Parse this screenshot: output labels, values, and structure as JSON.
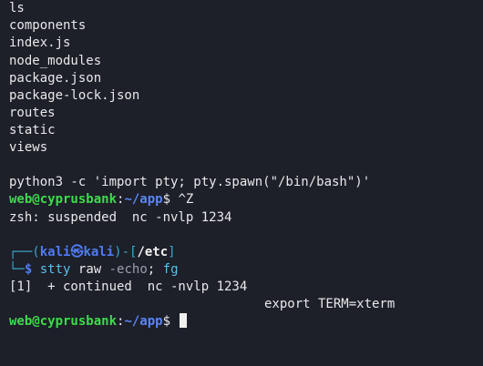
{
  "output_lines": [
    "ls",
    "components",
    "index.js",
    "node_modules",
    "package.json",
    "package-lock.json",
    "routes",
    "static",
    "views",
    "python3 -c 'import pty; pty.spawn(\"/bin/bash\")'"
  ],
  "prompt1": {
    "user_host": "web@cyprusbank",
    "sep": ":",
    "path": "~/app",
    "symbol": "$",
    "command": " ^Z"
  },
  "suspended_line": "zsh: suspended  nc -nvlp 1234",
  "kali_prompt": {
    "frame_top_left": "┌──(",
    "user": "kali",
    "at_symbol": "㉿",
    "host": "kali",
    "frame_mid": ")-[",
    "dir": "/etc",
    "frame_close": "]",
    "frame_bottom": "└─",
    "symbol": "$",
    "cmd_stty": "stty",
    "arg_raw": "raw",
    "arg_echo": "-echo",
    "sep": ";",
    "cmd_fg": "fg"
  },
  "job_line": "[1]  + continued  nc -nvlp 1234",
  "export_line": "export TERM=xterm",
  "prompt2": {
    "user_host": "web@cyprusbank",
    "sep": ":",
    "path": "~/app",
    "symbol": "$"
  },
  "colors": {
    "background": "#1d1f29",
    "text": "#e9e9ea",
    "prompt_green": "#3ddc4a",
    "prompt_blue": "#5c85f5",
    "kali_frame": "#3aa8ce"
  }
}
